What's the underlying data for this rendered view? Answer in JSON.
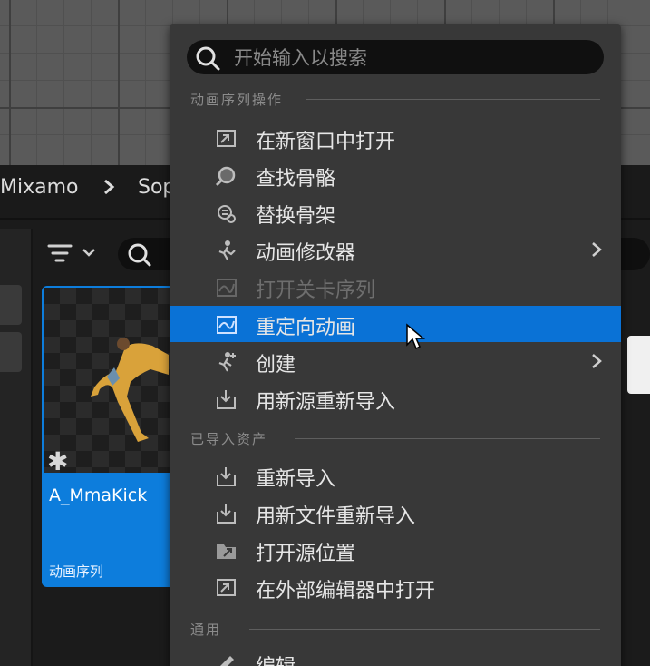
{
  "breadcrumb": {
    "items": [
      "Mixamo",
      "Sop"
    ]
  },
  "search": {
    "placeholder": "开始输入以搜索"
  },
  "sections": {
    "anim_ops": "动画序列操作",
    "imported": "已导入资产",
    "common": "通用"
  },
  "menu_items": [
    {
      "label": "在新窗口中打开",
      "icon": "open-window-icon",
      "disabled": false,
      "submenu": false
    },
    {
      "label": "查找骨骼",
      "icon": "find-skeleton-icon",
      "disabled": false,
      "submenu": false
    },
    {
      "label": "替换骨架",
      "icon": "replace-skeleton-icon",
      "disabled": false,
      "submenu": false
    },
    {
      "label": "动画修改器",
      "icon": "anim-modifier-icon",
      "disabled": false,
      "submenu": true
    },
    {
      "label": "打开关卡序列",
      "icon": "level-sequence-icon",
      "disabled": true,
      "submenu": false
    },
    {
      "label": "重定向动画",
      "icon": "retarget-icon",
      "disabled": false,
      "submenu": false,
      "active": true
    },
    {
      "label": "创建",
      "icon": "create-icon",
      "disabled": false,
      "submenu": true
    },
    {
      "label": "用新源重新导入",
      "icon": "reimport-new-source-icon",
      "disabled": false,
      "submenu": false
    },
    {
      "label": "重新导入",
      "icon": "reimport-icon",
      "disabled": false,
      "submenu": false
    },
    {
      "label": "用新文件重新导入",
      "icon": "reimport-new-file-icon",
      "disabled": false,
      "submenu": false
    },
    {
      "label": "打开源位置",
      "icon": "open-source-location-icon",
      "disabled": false,
      "submenu": false
    },
    {
      "label": "在外部编辑器中打开",
      "icon": "open-external-editor-icon",
      "disabled": false,
      "submenu": false
    },
    {
      "label": "编辑",
      "icon": "edit-icon",
      "disabled": false,
      "submenu": false
    }
  ],
  "asset": {
    "name": "A_MmaKick",
    "type": "动画序列"
  },
  "colors": {
    "accent": "#0a72d6",
    "menu_bg": "#383838",
    "card": "#0d7ddc"
  }
}
